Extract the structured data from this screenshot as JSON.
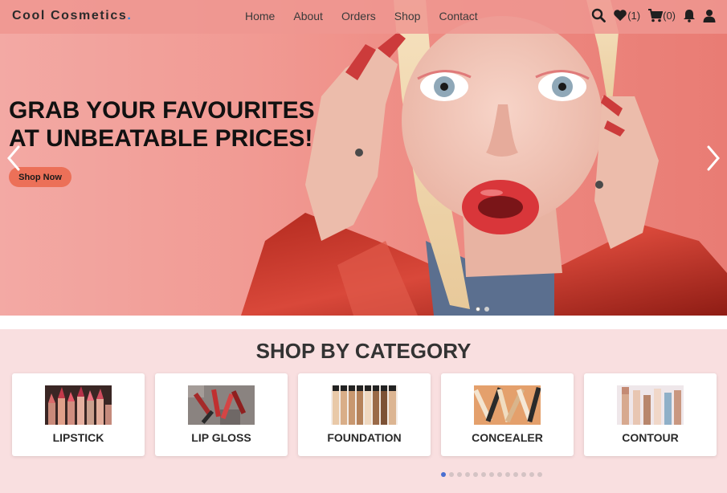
{
  "navbar": {
    "brand": "Cool Cosmetics",
    "brand_dot": ".",
    "links": [
      "Home",
      "About",
      "Orders",
      "Shop",
      "Contact"
    ],
    "wishlist_count": "(1)",
    "cart_count": "(0)",
    "icons": [
      "search-icon",
      "heart-icon",
      "cart-icon",
      "bell-icon",
      "user-icon"
    ]
  },
  "hero": {
    "title_line1": "GRAB YOUR FAVOURITES",
    "title_line2": "AT UNBEATABLE PRICES!",
    "cta_label": "Shop Now",
    "slide_count": 2,
    "active_slide": 0
  },
  "categories": {
    "title": "SHOP BY CATEGORY",
    "items": [
      {
        "label": "LIPSTICK"
      },
      {
        "label": "LIP GLOSS"
      },
      {
        "label": "FOUNDATION"
      },
      {
        "label": "CONCEALER"
      },
      {
        "label": "CONTOUR"
      }
    ],
    "page_count": 13,
    "active_page": 0
  },
  "colors": {
    "hero_bg": "#ef9089",
    "navbar_bg": "#ee9690",
    "cta": "#ec7058",
    "section_bg": "#f9dfe0",
    "active_dot": "#4a6fd1"
  }
}
